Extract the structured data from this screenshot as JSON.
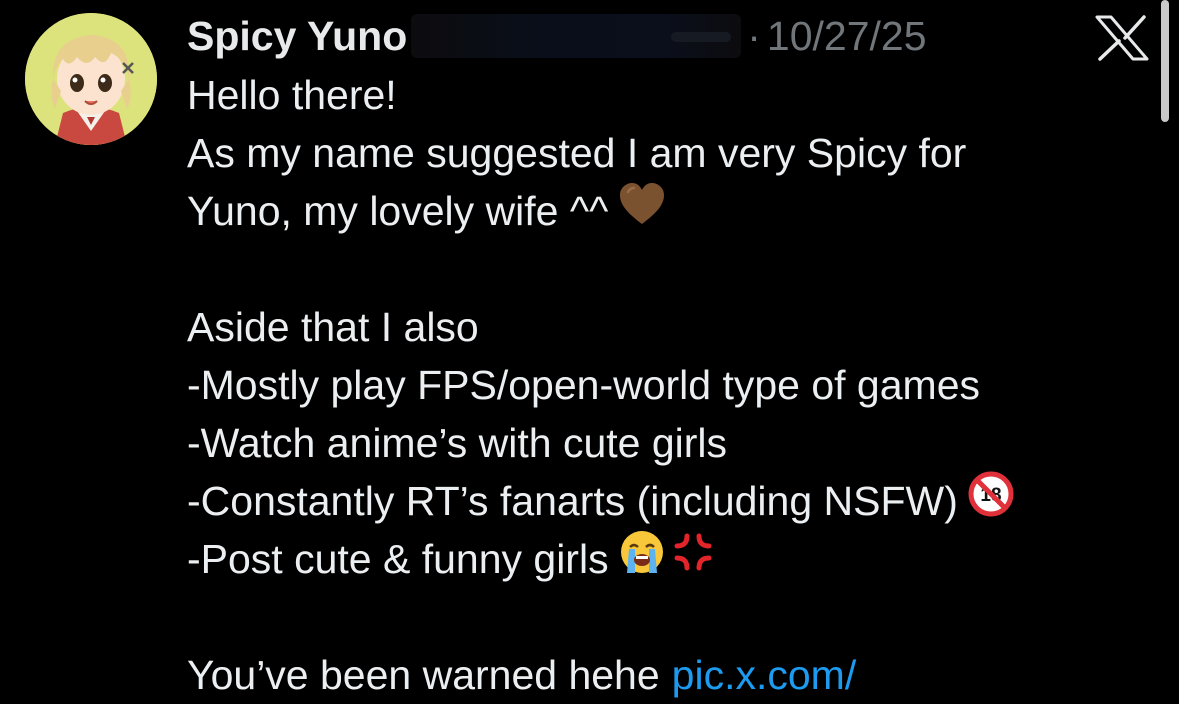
{
  "post": {
    "author": {
      "display_name": "Spicy Yuno",
      "handle_redacted": true
    },
    "separator": "·",
    "date": "10/27/25",
    "text": {
      "greeting": "Hello there!",
      "line_1": "As my name suggested I am very Spicy for",
      "line_2": "Yuno, my lovely wife ^^",
      "intro": "Aside that I also",
      "item_1": "-Mostly play FPS/open-world type of games",
      "item_2": "-Watch anime’s with cute girls",
      "item_3": "-Constantly RT’s fanarts (including NSFW)",
      "item_4": "-Post cute & funny girls",
      "closing": "You’ve been warned hehe",
      "link": "pic.x.com/"
    },
    "emojis": {
      "heart": "brown-heart",
      "nsfw": "no-one-under-eighteen",
      "cry": "loudly-crying-face",
      "anger": "anger-symbol"
    }
  },
  "app": {
    "logo": "x-logo-icon"
  },
  "colors": {
    "background": "#000000",
    "text": "#e7e9ea",
    "muted": "#71767b",
    "link": "#1d9bf0",
    "brown_heart": "#7a5230"
  }
}
